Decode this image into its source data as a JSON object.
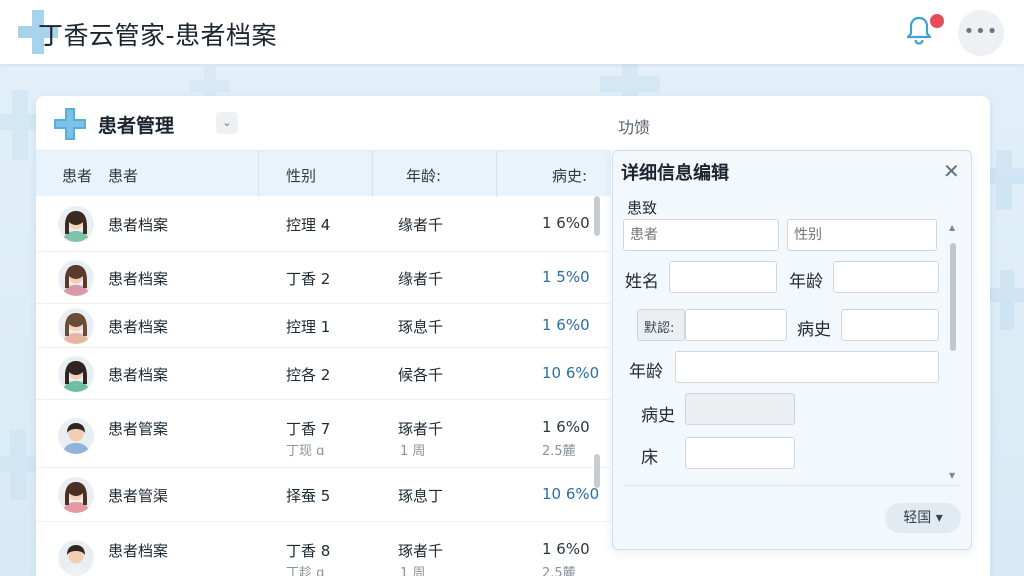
{
  "app": {
    "title": "丁香云管家-患者档案"
  },
  "topbar": {
    "more_label": "•••"
  },
  "card": {
    "title": "患者管理",
    "dropdown_glyph": "⌄",
    "feature_label": "功馈"
  },
  "table": {
    "headers": [
      "患者",
      "患者",
      "性别",
      "年龄:",
      "病史:"
    ],
    "rows": [
      {
        "name": "患者档案",
        "gender": "控理 4",
        "age": "缘者千",
        "history": "1 6%0",
        "history_blue": false,
        "gender_sub": "",
        "age_sub": "",
        "history_sub": "",
        "avatar": "female-a"
      },
      {
        "name": "患者档案",
        "gender": "丁香 2",
        "age": "缘者千",
        "history": "1 5%0",
        "history_blue": true,
        "gender_sub": "",
        "age_sub": "",
        "history_sub": "",
        "avatar": "female-b"
      },
      {
        "name": "患者档案",
        "gender": "控理 1",
        "age": "琢息千",
        "history": "1 6%0",
        "history_blue": true,
        "gender_sub": "",
        "age_sub": "",
        "history_sub": "",
        "avatar": "female-c"
      },
      {
        "name": "患者档案",
        "gender": "控各 2",
        "age": "候各千",
        "history": "10 6%0",
        "history_blue": true,
        "gender_sub": "",
        "age_sub": "",
        "history_sub": "",
        "avatar": "female-d"
      },
      {
        "name": "患者管案",
        "gender": "丁香 7",
        "age": "琢者千",
        "history": "1 6%0",
        "history_blue": false,
        "gender_sub": "丁现 ɑ",
        "age_sub": "1 周",
        "history_sub": "2.5麓",
        "avatar": "male-a"
      },
      {
        "name": "患者管渠",
        "gender": "择蚕 5",
        "age": "琢息丁",
        "history": "10 6%0",
        "history_blue": true,
        "gender_sub": "",
        "age_sub": "",
        "history_sub": "",
        "avatar": "female-e"
      },
      {
        "name": "患者档案",
        "gender": "丁香 8",
        "age": "琢者千",
        "history": "1 6%0",
        "history_blue": false,
        "gender_sub": "丁趁 ɑ",
        "age_sub": "1 周",
        "history_sub": "2.5麓",
        "avatar": "male-b"
      }
    ]
  },
  "panel": {
    "title": "详细信息编辑",
    "close_glyph": "✕",
    "section_label": "患致",
    "field_row1": {
      "placeholder_a": "患者",
      "placeholder_b": "性别"
    },
    "labels": {
      "name": "姓名",
      "age": "年龄",
      "small_box": "默認:",
      "history": "病史",
      "age2": "年龄",
      "history2": "病史",
      "bed": "床"
    },
    "button_label": "轻国 ▾"
  },
  "colors": {
    "accent": "#5aaed8",
    "header_bg": "#e9f3fb",
    "badge": "#e74c5a"
  }
}
